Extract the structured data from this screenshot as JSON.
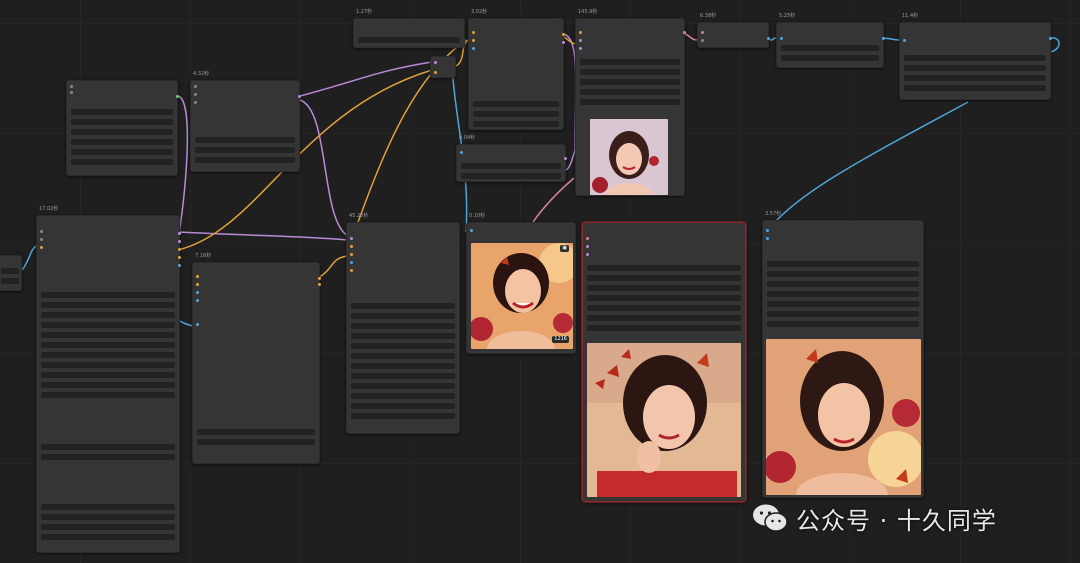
{
  "nodes": {
    "n1": {
      "title": "1.27秒"
    },
    "n2": {
      "title": "3.02秒"
    },
    "n3": {
      "title": "145.9秒"
    },
    "n4": {
      "title": "6.38秒"
    },
    "n5": {
      "title": "5.25秒"
    },
    "n6": {
      "title": "11.4秒"
    },
    "n7": {
      "title": ""
    },
    "n8": {
      "title": "4.32秒"
    },
    "n9": {
      "title": "0.04秒"
    },
    "n10": {
      "title": "17.02秒"
    },
    "n11": {
      "title": "7.16秒"
    },
    "n12": {
      "title": "45.20秒"
    },
    "n13": {
      "title": "0.10秒"
    },
    "n14": {
      "title": ""
    },
    "n15": {
      "title": "3.57秒"
    }
  },
  "preview_badge": "1216",
  "watermark": {
    "icon": "wechat-icon",
    "text": "公众号 · 十久同学"
  },
  "colors": {
    "wire_purple": "#b98bd6",
    "wire_orange": "#e0a13a",
    "wire_blue": "#4ea6dc",
    "wire_pink": "#d97fa3",
    "node_bg": "#353535",
    "selected_border": "#8b2b2b"
  }
}
